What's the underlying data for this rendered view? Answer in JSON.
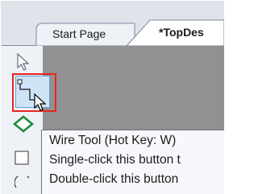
{
  "tabs": [
    {
      "label": "Start Page",
      "active": false
    },
    {
      "label": "*TopDes",
      "active": true
    }
  ],
  "toolbar": {
    "tools": [
      {
        "name": "select",
        "icon": "arrow-pointer-icon"
      },
      {
        "name": "wire",
        "icon": "wire-icon",
        "highlighted": true
      },
      {
        "name": "diamond",
        "icon": "diamond-icon"
      },
      {
        "name": "square",
        "icon": "square-icon"
      },
      {
        "name": "circle",
        "icon": "circle-icon"
      }
    ]
  },
  "tooltip": {
    "title": "Wire Tool (Hot Key: W)",
    "line2": "Single-click this button t",
    "line3": "Double-click this button"
  },
  "colors": {
    "highlight": "#e8251e",
    "canvas": "#919191",
    "tab_border": "#7d8aa0"
  }
}
